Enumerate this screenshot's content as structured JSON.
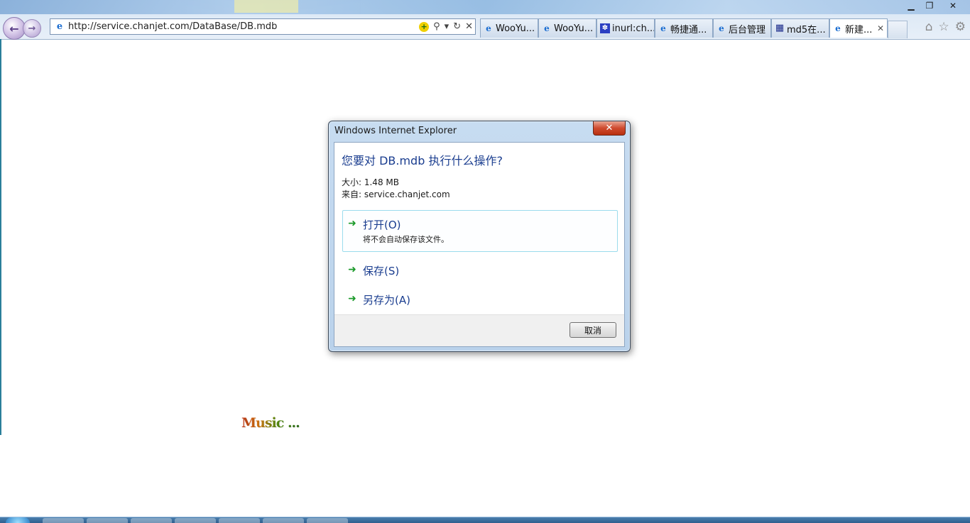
{
  "browser": {
    "url": "http://service.chanjet.com/DataBase/DB.mdb",
    "window_controls": {
      "minimize": "▁",
      "restore": "❐",
      "close": "✕"
    },
    "tabs": [
      {
        "label": "WooYu...",
        "icon": "ie-icon"
      },
      {
        "label": "WooYu...",
        "icon": "ie-icon"
      },
      {
        "label": "inurl:ch...",
        "icon": "baidu-paw-icon"
      },
      {
        "label": "畅捷通...",
        "icon": "ie-icon"
      },
      {
        "label": "后台管理",
        "icon": "ie-icon"
      },
      {
        "label": "md5在...",
        "icon": "cmd5-grid-icon"
      },
      {
        "label": "新建...",
        "icon": "ie-icon",
        "active": true,
        "close": "✕"
      }
    ],
    "command_icons": [
      "home-icon",
      "favorites-star-icon",
      "tools-gear-icon"
    ]
  },
  "page": {
    "music_text": "Music ..."
  },
  "dialog": {
    "title": "Windows Internet Explorer",
    "close_glyph": "✕",
    "question": "您要对 DB.mdb 执行什么操作?",
    "size_line": "大小: 1.48 MB",
    "from_line": "来自: service.chanjet.com",
    "options": {
      "open": {
        "label": "打开(O)",
        "sub": "将不会自动保存该文件。"
      },
      "save": {
        "label": "保存(S)"
      },
      "save_as": {
        "label": "另存为(A)"
      }
    },
    "cancel_label": "取消"
  },
  "colors": {
    "dialog_heading": "#1a3d8f",
    "arrow_green": "#1b9a2a",
    "close_red": "#cf4b2f",
    "hover_border": "#9bdced"
  }
}
